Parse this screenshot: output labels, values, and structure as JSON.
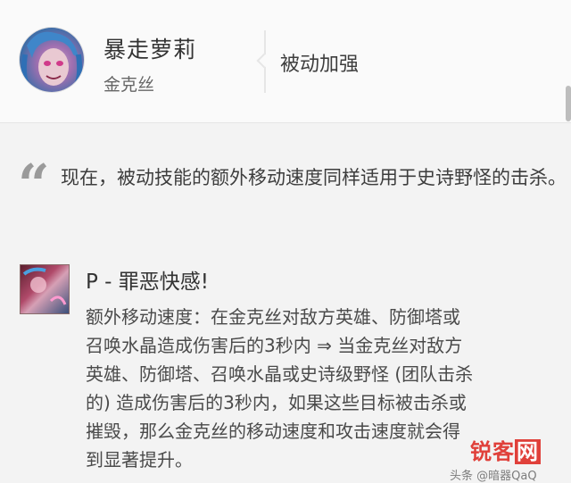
{
  "header": {
    "champion_name": "暴走萝莉",
    "champion_title": "金克丝",
    "change_type": "被动加强"
  },
  "quote": {
    "mark": "“",
    "text": "现在，被动技能的额外移动速度同样适用于史诗野怪的击杀。"
  },
  "skill": {
    "title": "P - 罪恶快感!",
    "description_lines": [
      "额外移动速度：在金克丝对敌方英雄、防御塔或",
      "召唤水晶造成伤害后的3秒内 ⇒ 当金克丝对敌方",
      "英雄、防御塔、召唤水晶或史诗级野怪 (团队击杀",
      "的) 造成伤害后的3秒内，如果这些目标被击杀或",
      "摧毁，那么金克丝的移动速度和攻击速度就会得",
      "到显著提升。"
    ]
  },
  "watermark": {
    "logo_a": "锐客",
    "logo_b": "网",
    "source": "头条 @暗器QaQ"
  }
}
